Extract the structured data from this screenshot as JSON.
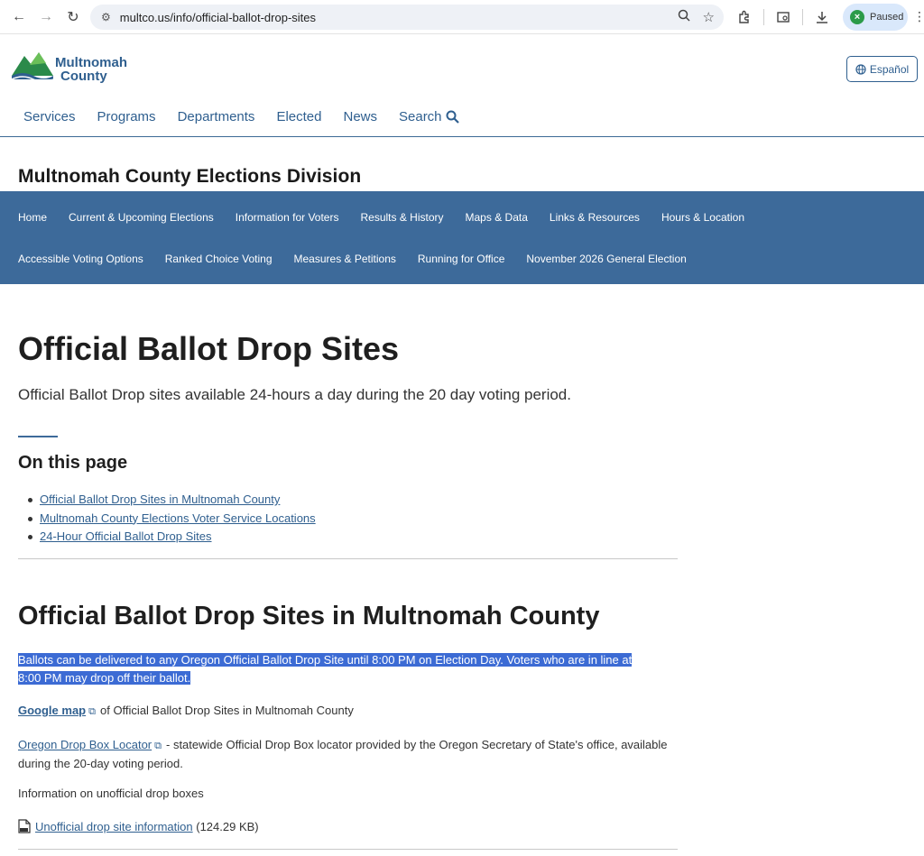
{
  "browser": {
    "url": "multco.us/info/official-ballot-drop-sites",
    "profile_status": "Paused"
  },
  "site": {
    "logo_line1": "Multnomah",
    "logo_line2": "County",
    "language_button": "Español",
    "nav": [
      "Services",
      "Programs",
      "Departments",
      "Elected",
      "News",
      "Search"
    ]
  },
  "division": {
    "title": "Multnomah County Elections Division",
    "nav_row1": [
      "Home",
      "Current & Upcoming Elections",
      "Information for Voters",
      "Results & History",
      "Maps & Data",
      "Links & Resources",
      "Hours & Location"
    ],
    "nav_row2": [
      "Accessible Voting Options",
      "Ranked Choice Voting",
      "Measures & Petitions",
      "Running for Office",
      "November 2026 General Election"
    ]
  },
  "page": {
    "title": "Official Ballot Drop Sites",
    "subtitle": "Official Ballot Drop sites available 24-hours a day during the 20 day voting period.",
    "on_this_page_title": "On this page",
    "on_this_page_links": [
      "Official Ballot Drop Sites in Multnomah County",
      "Multnomah County Elections Voter Service Locations",
      "24-Hour Official Ballot Drop Sites"
    ],
    "section_title": "Official Ballot Drop Sites in Multnomah County",
    "highlight_line1": "Ballots can be delivered to any Oregon Official Ballot Drop Site until 8:00 PM on Election Day. Voters who are in line at",
    "highlight_line2": "8:00 PM may drop off their ballot.",
    "google_link": "Google map",
    "google_text": "of Official Ballot Drop Sites in Multnomah County",
    "oregon_link": "Oregon Drop Box Locator",
    "oregon_text": "- statewide Official Drop Box locator provided by the Oregon Secretary of State's office, available during the 20-day voting period.",
    "info_text": "Information on unofficial drop boxes",
    "pdf_link": "Unofficial drop site information",
    "pdf_size": "(124.29 KB)"
  }
}
